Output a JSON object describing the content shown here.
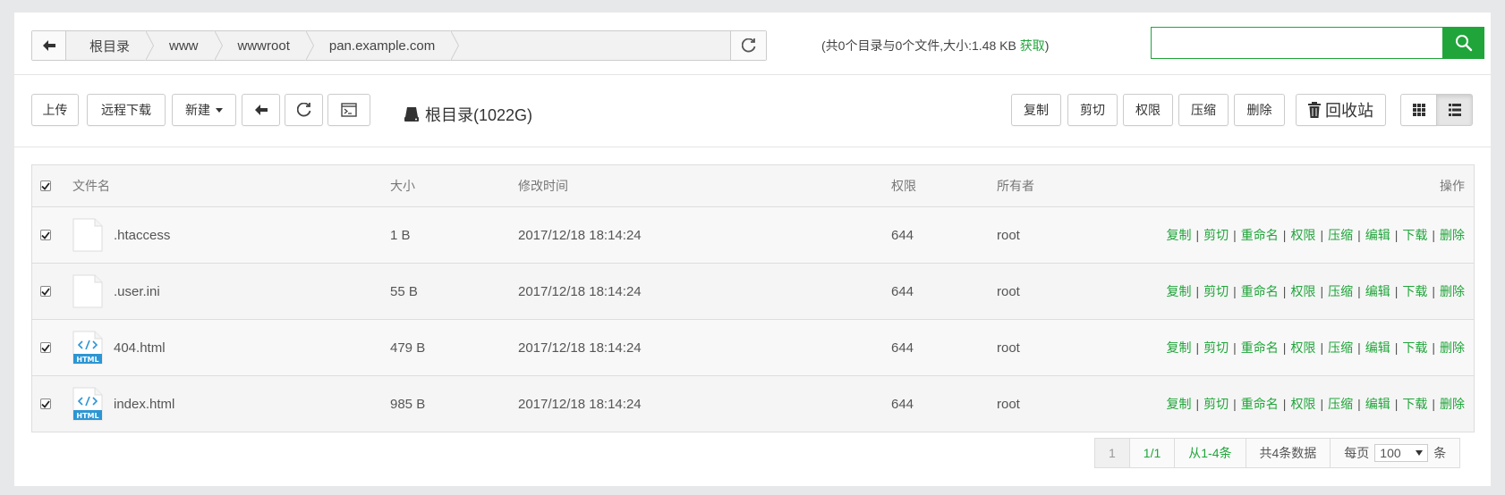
{
  "breadcrumb": [
    "根目录",
    "www",
    "wwwroot",
    "pan.example.com"
  ],
  "dir_info": {
    "text": "(共0个目录与0个文件,大小:1.48 KB",
    "fetch_link": "获取",
    "close": ")"
  },
  "search": {
    "placeholder": "",
    "value": ""
  },
  "toolbar": {
    "upload": "上传",
    "remote_download": "远程下载",
    "new": "新建",
    "disk_label": "根目录(1022G)",
    "copy": "复制",
    "cut": "剪切",
    "permission": "权限",
    "compress": "压缩",
    "delete": "删除",
    "recycle": "回收站"
  },
  "table": {
    "headers": {
      "name": "文件名",
      "size": "大小",
      "time": "修改时间",
      "perm": "权限",
      "owner": "所有者",
      "ops": "操作"
    },
    "ops": [
      "复制",
      "剪切",
      "重命名",
      "权限",
      "压缩",
      "编辑",
      "下载",
      "删除"
    ],
    "rows": [
      {
        "name": ".htaccess",
        "size": "1 B",
        "time": "2017/12/18 18:14:24",
        "perm": "644",
        "owner": "root",
        "icon": "file-icon"
      },
      {
        "name": ".user.ini",
        "size": "55 B",
        "time": "2017/12/18 18:14:24",
        "perm": "644",
        "owner": "root",
        "icon": "file-icon"
      },
      {
        "name": "404.html",
        "size": "479 B",
        "time": "2017/12/18 18:14:24",
        "perm": "644",
        "owner": "root",
        "icon": "html-file-icon"
      },
      {
        "name": "index.html",
        "size": "985 B",
        "time": "2017/12/18 18:14:24",
        "perm": "644",
        "owner": "root",
        "icon": "html-file-icon"
      }
    ]
  },
  "pager": {
    "current": "1",
    "pages": "1/1",
    "range": "从1-4条",
    "total": "共4条数据",
    "per_page_label": "每页",
    "per_page_value": "100",
    "unit": "条"
  },
  "colors": {
    "accent": "#20a53a"
  }
}
